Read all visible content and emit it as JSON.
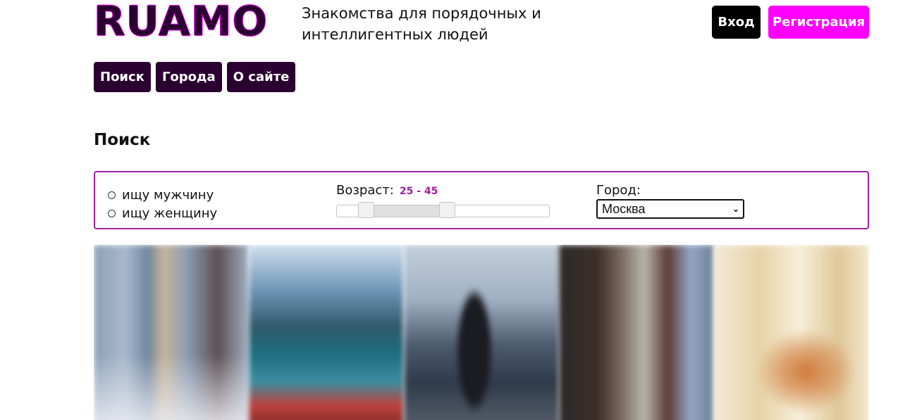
{
  "header": {
    "logo_text": "RUAMO",
    "tagline": "Знакомства для порядочных и интеллигентных людей",
    "login_label": "Вход",
    "register_label": "Регистрация"
  },
  "nav": {
    "items": [
      {
        "label": "Поиск"
      },
      {
        "label": "Города"
      },
      {
        "label": "О сайте"
      }
    ]
  },
  "search": {
    "title": "Поиск",
    "gender_options": [
      {
        "label": "ищу мужчину",
        "checked": false
      },
      {
        "label": "ищу женщину",
        "checked": false
      }
    ],
    "age": {
      "label": "Возраст:",
      "value_text": "25 - 45",
      "min": 25,
      "max": 45
    },
    "city": {
      "label": "Город:",
      "selected": "Москва"
    }
  },
  "gallery": {
    "photos": [
      {
        "name": "profile-photo-1"
      },
      {
        "name": "profile-photo-2"
      },
      {
        "name": "profile-photo-3"
      },
      {
        "name": "profile-photo-4"
      },
      {
        "name": "profile-photo-5"
      }
    ]
  },
  "colors": {
    "brand_dark": "#2a0030",
    "accent": "#ff00ff",
    "border_accent": "#a020a0"
  }
}
